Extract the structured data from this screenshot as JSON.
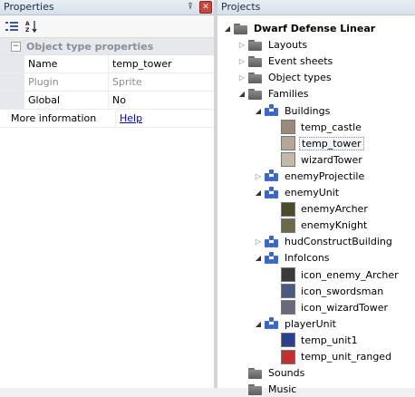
{
  "properties": {
    "title": "Properties",
    "pin_glyph": "⍒",
    "close_glyph": "✕",
    "category": "Object type properties",
    "rows": [
      {
        "key": "Name",
        "value": "temp_tower",
        "disabled": false
      },
      {
        "key": "Plugin",
        "value": "Sprite",
        "disabled": true
      },
      {
        "key": "Global",
        "value": "No",
        "disabled": false
      }
    ],
    "more_info": {
      "key": "More information",
      "link": "Help"
    }
  },
  "projects": {
    "title": "Projects",
    "root": "Dwarf Defense Linear",
    "folders": [
      "Layouts",
      "Event sheets",
      "Object types",
      "Families"
    ],
    "families": [
      {
        "name": "Buildings",
        "expanded": true,
        "items": [
          "temp_castle",
          "temp_tower",
          "wizardTower"
        ],
        "selected": "temp_tower"
      },
      {
        "name": "enemyProjectile",
        "expanded": false,
        "items": []
      },
      {
        "name": "enemyUnit",
        "expanded": true,
        "items": [
          "enemyArcher",
          "enemyKnight"
        ]
      },
      {
        "name": "hudConstructBuilding",
        "expanded": false,
        "items": []
      },
      {
        "name": "InfoIcons",
        "expanded": true,
        "items": [
          "icon_enemy_Archer",
          "icon_swordsman",
          "icon_wizardTower"
        ]
      },
      {
        "name": "playerUnit",
        "expanded": true,
        "items": [
          "temp_unit1",
          "temp_unit_ranged"
        ]
      }
    ],
    "bottom_folders": [
      "Sounds",
      "Music"
    ]
  }
}
